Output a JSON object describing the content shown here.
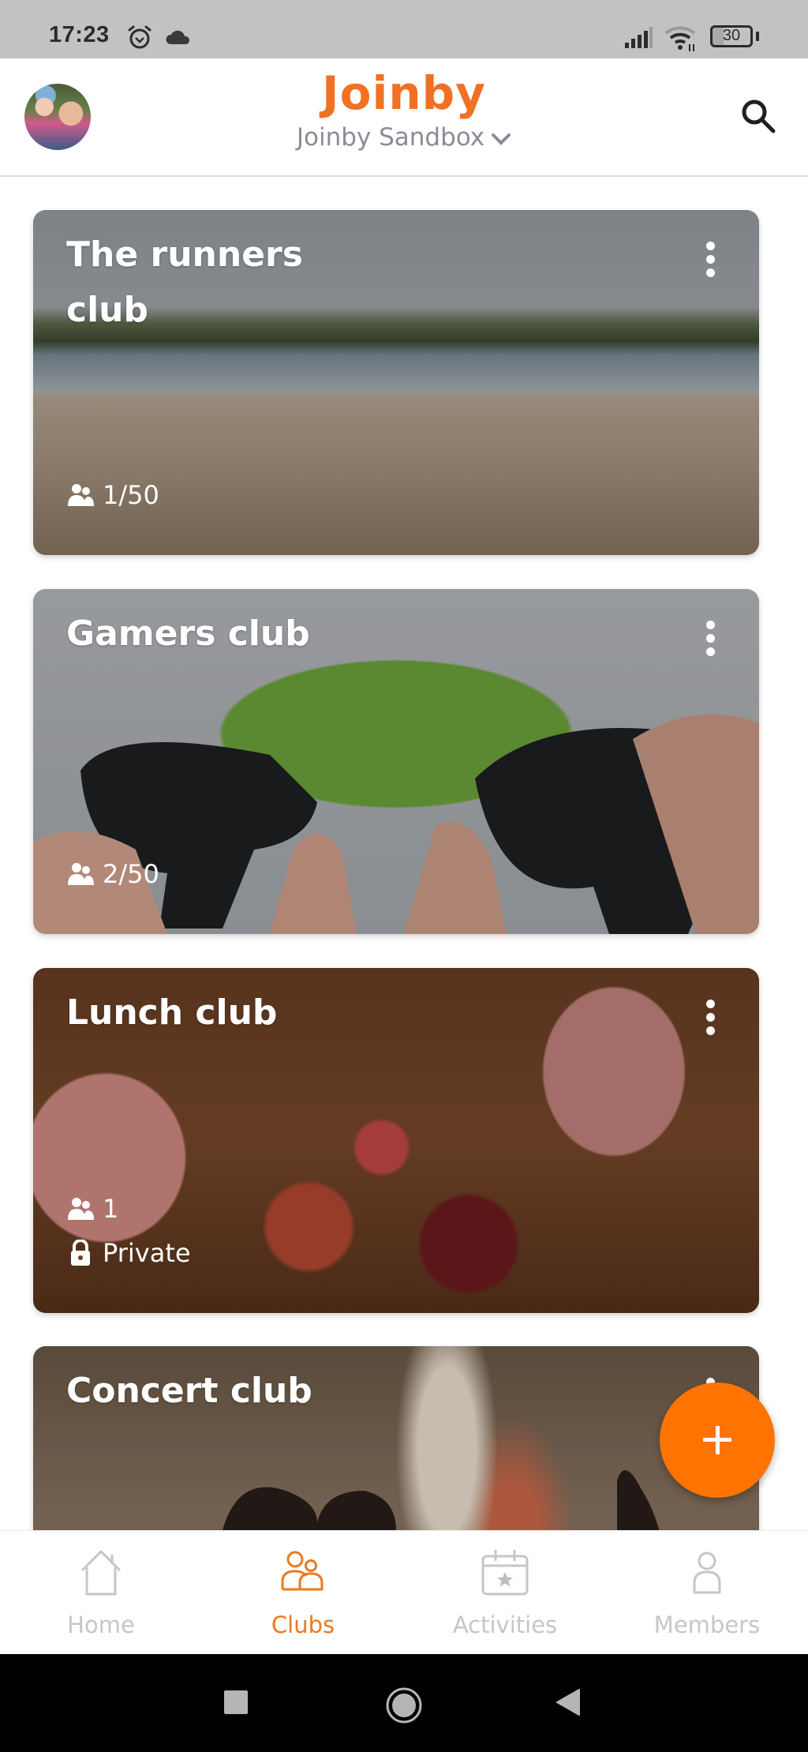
{
  "status_bar": {
    "time": "17:23",
    "battery": "30",
    "icons": [
      "alarm-icon",
      "cloud-icon",
      "signal-icon",
      "wifi-icon",
      "battery-icon"
    ]
  },
  "header": {
    "logo": "Joinby",
    "workspace": "Joinby Sandbox",
    "workspace_icon": "chevron-down-icon",
    "search_icon": "search-icon",
    "avatar": "user-avatar"
  },
  "clubs": [
    {
      "title": "The runners club",
      "members": "1/50",
      "private": false
    },
    {
      "title": "Gamers club",
      "members": "2/50",
      "private": false
    },
    {
      "title": "Lunch club",
      "members": "1",
      "private": true,
      "private_label": "Private"
    },
    {
      "title": "Concert club"
    }
  ],
  "fab": {
    "icon": "plus-icon"
  },
  "bottom_nav": {
    "active": "Clubs",
    "items": [
      {
        "label": "Home",
        "icon": "home-icon"
      },
      {
        "label": "Clubs",
        "icon": "clubs-icon"
      },
      {
        "label": "Activities",
        "icon": "calendar-star-icon"
      },
      {
        "label": "Members",
        "icon": "member-icon"
      }
    ]
  },
  "colors": {
    "brand": "#f07124",
    "fab": "#ff7300",
    "nav_active": "#ea7a1e",
    "nav_inactive": "#c6c6c6",
    "subtitle": "#8a8d96"
  }
}
